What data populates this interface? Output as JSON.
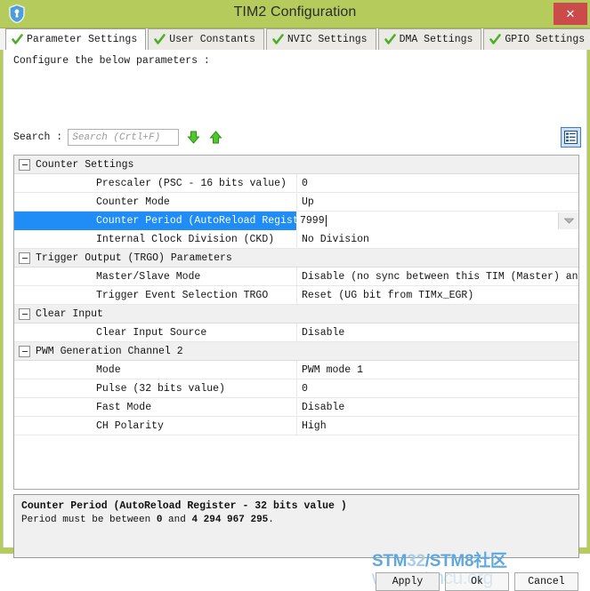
{
  "window": {
    "title": "TIM2 Configuration",
    "app_icon": "shield-icon",
    "close_label": "✕",
    "titlebar_color": "#b5cc5d",
    "close_color": "#cb4b4b"
  },
  "tabs": [
    {
      "label": "Parameter Settings",
      "icon": "green-check-icon",
      "active": true
    },
    {
      "label": "User Constants",
      "icon": "green-check-icon",
      "active": false
    },
    {
      "label": "NVIC Settings",
      "icon": "green-check-icon",
      "active": false
    },
    {
      "label": "DMA Settings",
      "icon": "green-check-icon",
      "active": false
    },
    {
      "label": "GPIO Settings",
      "icon": "green-check-icon",
      "active": false
    }
  ],
  "content": {
    "configure_label": "Configure the below parameters :",
    "search_label": "Search :",
    "search_value": "",
    "search_placeholder": "Search (Crtl+F)",
    "search_next_icon": "arrow-down-icon",
    "search_prev_icon": "arrow-up-icon",
    "list_toggle_icon": "list-view-icon"
  },
  "table": {
    "groups": [
      {
        "name": "Counter Settings",
        "expanded": true,
        "rows": [
          {
            "name": "Prescaler (PSC - 16 bits value)",
            "value": "0",
            "selected": false
          },
          {
            "name": "Counter Mode",
            "value": "Up",
            "selected": false
          },
          {
            "name": "Counter Period (AutoReload Registe...",
            "value": "7999",
            "selected": true,
            "editing": true
          },
          {
            "name": "Internal Clock Division (CKD)",
            "value": "No Division",
            "selected": false
          }
        ]
      },
      {
        "name": "Trigger Output (TRGO) Parameters",
        "expanded": true,
        "rows": [
          {
            "name": "Master/Slave Mode",
            "value": "Disable (no sync between this TIM (Master) and it...",
            "selected": false
          },
          {
            "name": "Trigger Event Selection TRGO",
            "value": "Reset (UG bit from TIMx_EGR)",
            "selected": false
          }
        ]
      },
      {
        "name": "Clear Input",
        "expanded": true,
        "rows": [
          {
            "name": "Clear Input Source",
            "value": "Disable",
            "selected": false
          }
        ]
      },
      {
        "name": "PWM Generation Channel 2",
        "expanded": true,
        "rows": [
          {
            "name": "Mode",
            "value": "PWM mode 1",
            "selected": false
          },
          {
            "name": "Pulse (32 bits value)",
            "value": "0",
            "selected": false
          },
          {
            "name": "Fast Mode",
            "value": "Disable",
            "selected": false
          },
          {
            "name": "CH Polarity",
            "value": "High",
            "selected": false
          }
        ]
      }
    ]
  },
  "description": {
    "title": "Counter Period (AutoReload Register - 32 bits value )",
    "body_prefix": "Period must be between ",
    "body_min": "0",
    "body_mid": " and ",
    "body_max": "4 294 967 295",
    "body_suffix": "."
  },
  "watermark": {
    "line1_a": "STM",
    "line1_b": "32",
    "line1_c": "/STM",
    "line1_d": "8社区",
    "line2": "www.stmcu.org"
  },
  "buttons": {
    "apply": "Apply",
    "ok": "Ok",
    "cancel": "Cancel"
  }
}
